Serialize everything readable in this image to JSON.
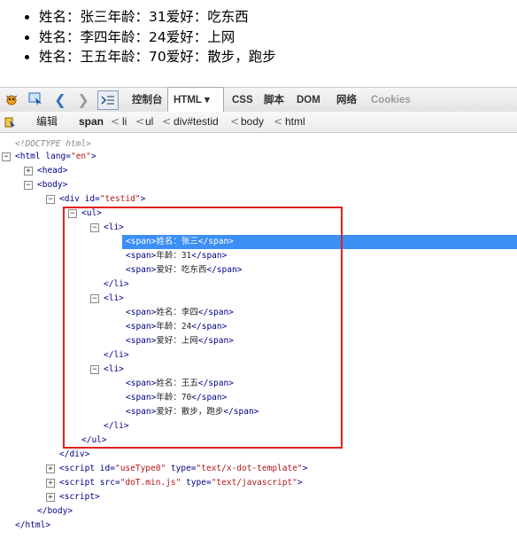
{
  "page_list": [
    "姓名：张三年龄：31爱好：吃东西",
    "姓名：李四年龄：24爱好：上网",
    "姓名：王五年龄：70爱好：散步，跑步"
  ],
  "toolbar": {
    "tabs": [
      "控制台",
      "HTML",
      "CSS",
      "脚本",
      "DOM",
      "网络",
      "Cookies"
    ],
    "active_tab": "HTML",
    "dropdown_glyph": "▾"
  },
  "breadcrumbs": {
    "edit_label": "编辑",
    "items": [
      "span",
      "li",
      "ul",
      "div#testid",
      "body",
      "html"
    ],
    "separator": "<"
  },
  "tree": {
    "doctype": "<!DOCTYPE html>",
    "html_open": "<html",
    "html_attr": "lang",
    "html_val": "\"en\"",
    "head": "<head>",
    "body_open": "<body>",
    "div_open": "<div",
    "div_attr": "id",
    "div_val": "\"testid\"",
    "ul_open": "<ul>",
    "li_open": "<li>",
    "span_open": "<span>",
    "span_close": "</span>",
    "li_close": "</li>",
    "ul_close": "</ul>",
    "div_close": "</div>",
    "li1": [
      "姓名：张三",
      "年龄：31",
      "爱好：吃东西"
    ],
    "li2": [
      "姓名：李四",
      "年龄：24",
      "爱好：上网"
    ],
    "li3": [
      "姓名：王五",
      "年龄：70",
      "爱好：散步，跑步"
    ],
    "script1_open": "<script",
    "script1_attr1": "id",
    "script1_val1": "\"useType0\"",
    "script1_attr2": "type",
    "script1_val2": "\"text/x-dot-template\"",
    "script2_attr1": "src",
    "script2_val1": "\"doT.min.js\"",
    "script2_attr2": "type",
    "script2_val2": "\"text/javascript\"",
    "script3": "<script>",
    "body_close": "</body>",
    "html_close": "</html>",
    "eq": "=",
    "gt": ">"
  },
  "colors": {
    "selection": "#3c8ff5",
    "highlight_box": "#e02020"
  }
}
